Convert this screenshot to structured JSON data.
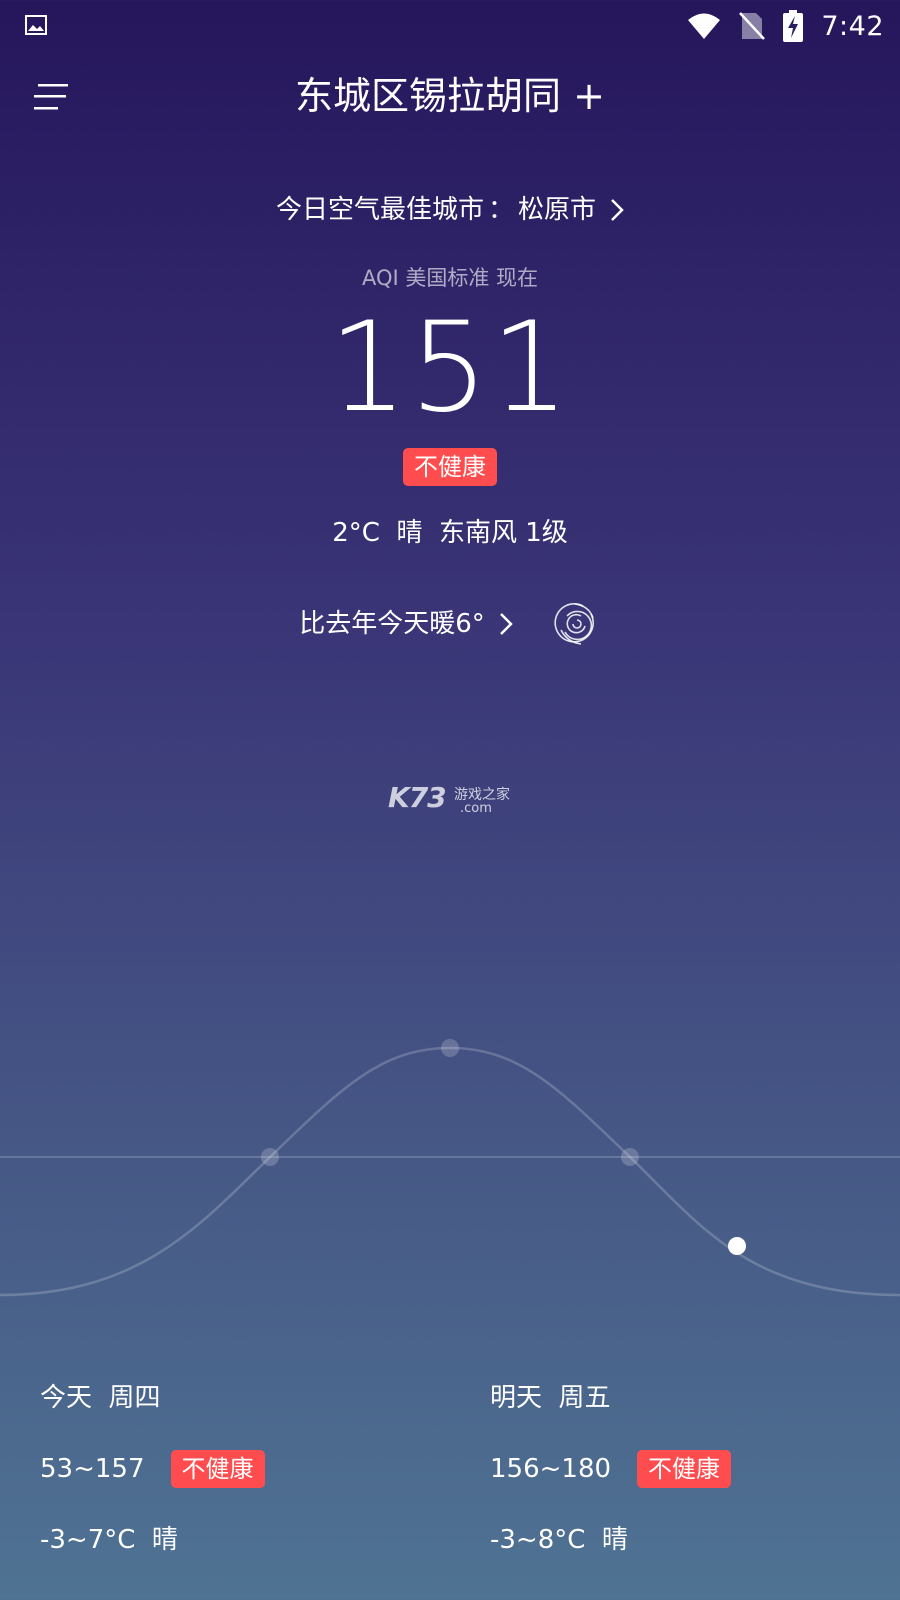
{
  "status_bar": {
    "time": "7:42",
    "icons": [
      "image-icon",
      "wifi-icon",
      "no-sim-icon",
      "battery-charging-icon"
    ]
  },
  "header": {
    "menu_icon": "menu-icon",
    "location": "东城区锡拉胡同 +"
  },
  "best_city": {
    "label": "今日空气最佳城市",
    "separator": "：",
    "city": "松原市"
  },
  "aqi": {
    "label": "AQI 美国标准 现在",
    "value": "151",
    "level": "不健康",
    "level_color": "#ff4d4f"
  },
  "current_weather": "2°C  晴  东南风 1级",
  "compare": {
    "text": "比去年今天暖6°",
    "icon": "swirl-icon"
  },
  "watermark": {
    "logo": "K73",
    "name": "游戏之家",
    "domain": ".com"
  },
  "forecast": [
    {
      "day": "今天  周四",
      "aqi_range": "53~157",
      "level": "不健康",
      "weather": "-3~7°C  晴"
    },
    {
      "day": "明天  周五",
      "aqi_range": "156~180",
      "level": "不健康",
      "weather": "-3~8°C  晴"
    }
  ],
  "colors": {
    "badge": "#ff4d4f",
    "background_top": "#26165c",
    "background_bottom": "#4f7393"
  }
}
